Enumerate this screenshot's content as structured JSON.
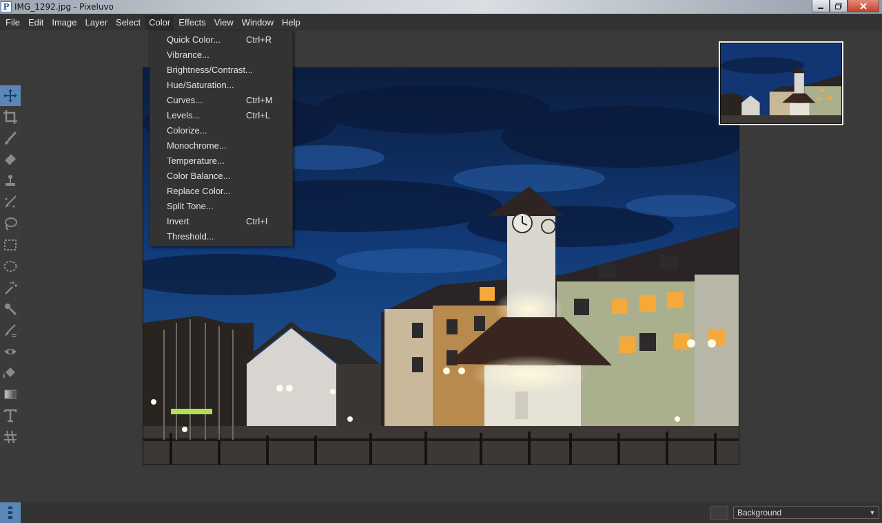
{
  "window": {
    "title": "IMG_1292.jpg - Pixeluvo",
    "app_icon_letter": "P",
    "minimize_icon": "minimize-icon",
    "maximize_icon": "maximize-icon",
    "close_icon": "close-icon"
  },
  "menubar": {
    "items": [
      "File",
      "Edit",
      "Image",
      "Layer",
      "Select",
      "Color",
      "Effects",
      "View",
      "Window",
      "Help"
    ],
    "active": "Color"
  },
  "color_menu": {
    "items": [
      {
        "label": "Quick Color...",
        "shortcut": "Ctrl+R"
      },
      {
        "label": "Vibrance...",
        "shortcut": ""
      },
      {
        "label": "Brightness/Contrast...",
        "shortcut": ""
      },
      {
        "label": "Hue/Saturation...",
        "shortcut": ""
      },
      {
        "label": "Curves...",
        "shortcut": "Ctrl+M"
      },
      {
        "label": "Levels...",
        "shortcut": "Ctrl+L"
      },
      {
        "label": "Colorize...",
        "shortcut": ""
      },
      {
        "label": "Monochrome...",
        "shortcut": ""
      },
      {
        "label": "Temperature...",
        "shortcut": ""
      },
      {
        "label": "Color Balance...",
        "shortcut": ""
      },
      {
        "label": "Replace Color...",
        "shortcut": ""
      },
      {
        "label": "Split Tone...",
        "shortcut": ""
      },
      {
        "label": "Invert",
        "shortcut": "Ctrl+I"
      },
      {
        "label": "Threshold...",
        "shortcut": ""
      }
    ]
  },
  "toolbar": {
    "tools": [
      "move-icon",
      "crop-icon",
      "brush-icon",
      "eraser-icon",
      "clone-stamp-icon",
      "healing-icon",
      "lasso-icon",
      "rect-select-icon",
      "ellipse-select-icon",
      "magic-wand-icon",
      "smudge-icon",
      "dodge-burn-icon",
      "red-eye-icon",
      "paint-bucket-icon",
      "gradient-icon",
      "text-icon",
      "transform-icon"
    ],
    "active_tool": "move-icon"
  },
  "layers": {
    "selected": "Background"
  },
  "colors": {
    "accent": "#5a86b8",
    "menu_bg": "#333333",
    "workspace_bg": "#3a3a3a"
  }
}
